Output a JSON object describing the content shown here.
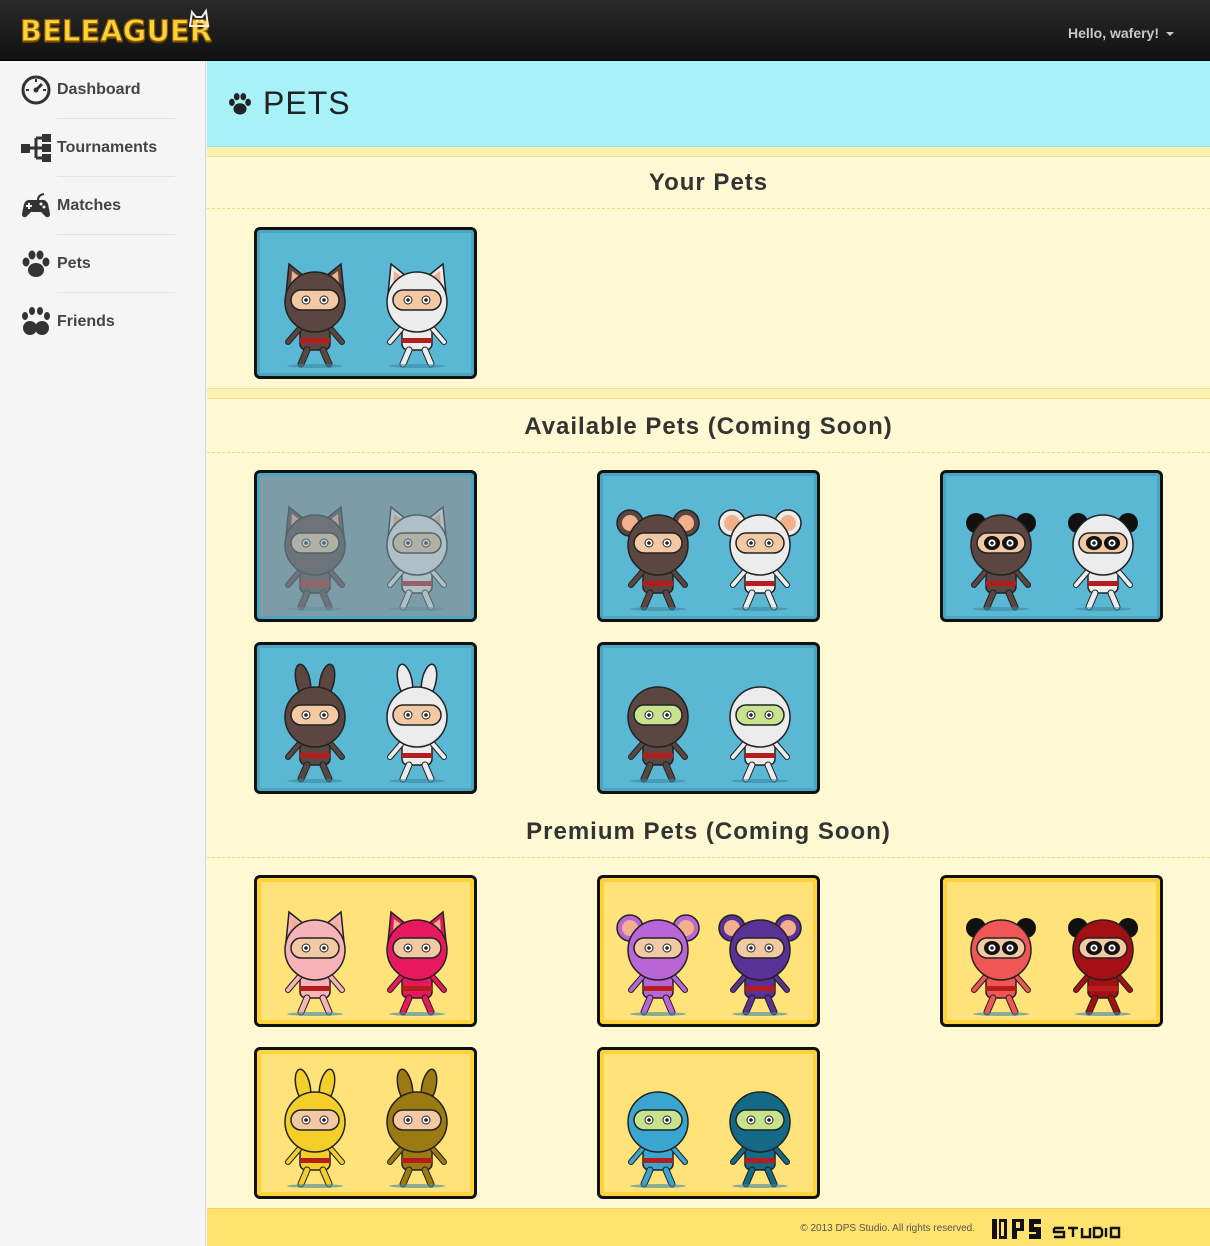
{
  "app": {
    "logo_text": "BELEAGUER",
    "user_greeting": "Hello, wafery!"
  },
  "sidebar": {
    "items": [
      {
        "label": "Dashboard",
        "icon": "dashboard-gauge-icon"
      },
      {
        "label": "Tournaments",
        "icon": "tournament-bracket-icon"
      },
      {
        "label": "Matches",
        "icon": "gamepad-icon"
      },
      {
        "label": "Pets",
        "icon": "paw-icon"
      },
      {
        "label": "Friends",
        "icon": "friends-paws-icon"
      }
    ]
  },
  "page": {
    "title": "PETS",
    "icon": "paw-icon"
  },
  "sections": {
    "your_pets": {
      "title": "Your Pets"
    },
    "available": {
      "title": "Available Pets (Coming Soon)"
    },
    "premium": {
      "title": "Premium Pets (Coming Soon)"
    }
  },
  "footer": {
    "copyright": "© 2013 DPS Studio. All rights reserved.",
    "studio_logo": "DPS STUDIO"
  },
  "colors": {
    "accent_yellow": "#ffd23a",
    "header_cyan": "#a6f2f8",
    "card_blue": "#5ab8d4",
    "card_gold": "#ffe37a",
    "content_bg": "#fff9d3"
  }
}
